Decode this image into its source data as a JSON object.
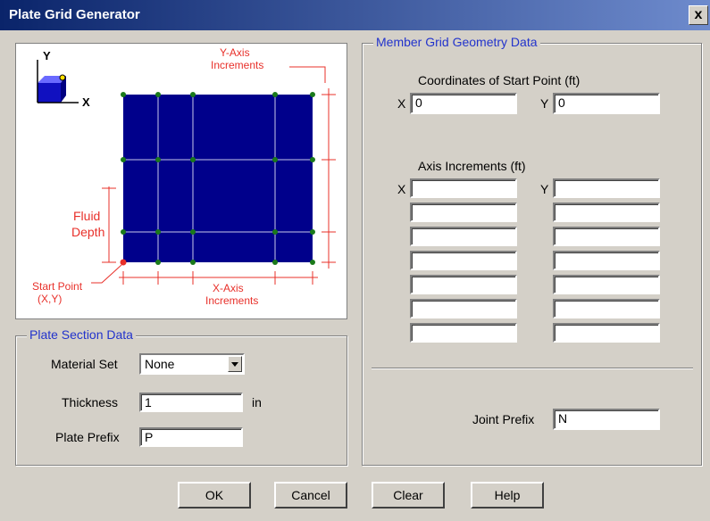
{
  "window": {
    "title": "Plate Grid Generator",
    "close_glyph": "x"
  },
  "diagram": {
    "y_label": "Y",
    "x_label": "X",
    "y_axis_increments": [
      "Y-Axis",
      "Increments"
    ],
    "x_axis_increments": [
      "X-Axis",
      "Increments"
    ],
    "fluid_depth": [
      "Fluid",
      "Depth"
    ],
    "start_point": [
      "Start Point",
      "(X,Y)"
    ],
    "plate_color": "#00008b",
    "dim_color": "#e8302a"
  },
  "plate_section": {
    "title": "Plate Section Data",
    "material_set_label": "Material Set",
    "material_set_value": "None",
    "thickness_label": "Thickness",
    "thickness_value": "1",
    "thickness_unit": "in",
    "plate_prefix_label": "Plate Prefix",
    "plate_prefix_value": "P"
  },
  "member_grid": {
    "title": "Member Grid Geometry Data",
    "coords_title": "Coordinates of Start Point  (ft)",
    "x_label": "X",
    "x_value": "0",
    "y_label": "Y",
    "y_value": "0",
    "increments_title": "Axis Increments  (ft)",
    "inc_x_label": "X",
    "inc_y_label": "Y",
    "joint_prefix_label": "Joint Prefix",
    "joint_prefix_value": "N"
  },
  "buttons": {
    "ok": "OK",
    "cancel": "Cancel",
    "clear": "Clear",
    "help": "Help"
  }
}
